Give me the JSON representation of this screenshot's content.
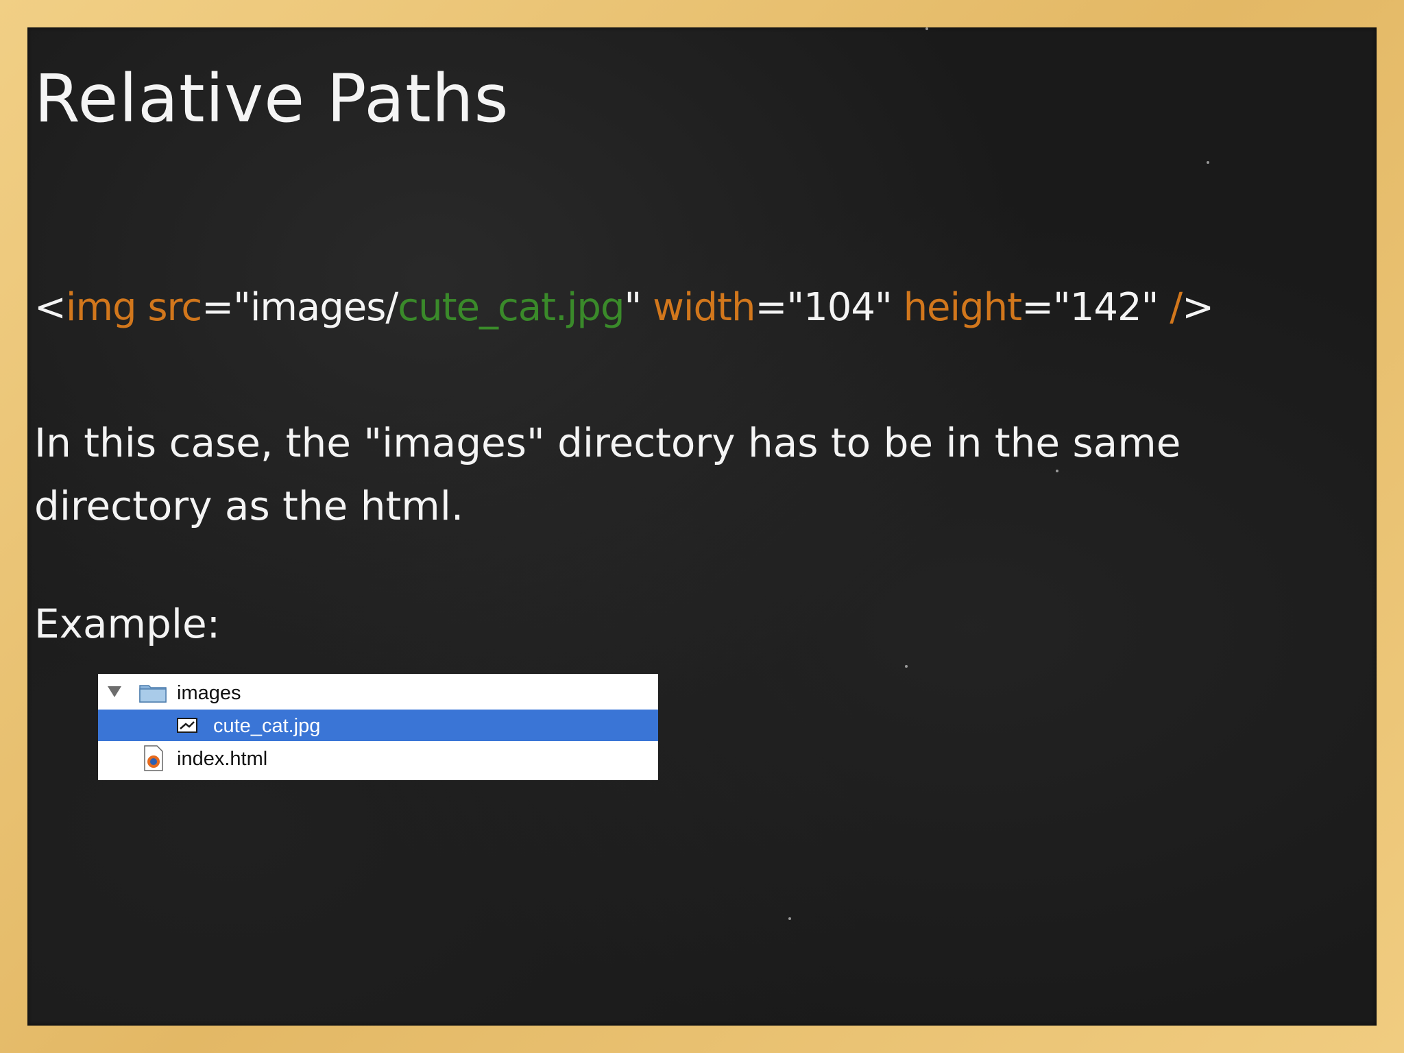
{
  "slide": {
    "title": "Relative Paths",
    "code_tokens": [
      {
        "text": "<",
        "color": "white"
      },
      {
        "text": "img src",
        "color": "orange"
      },
      {
        "text": "=\"images/",
        "color": "white"
      },
      {
        "text": "cute_cat.jpg",
        "color": "green"
      },
      {
        "text": "\" ",
        "color": "white"
      },
      {
        "text": "width",
        "color": "orange"
      },
      {
        "text": "=\"104\" ",
        "color": "white"
      },
      {
        "text": "height",
        "color": "orange"
      },
      {
        "text": "=\"142\" ",
        "color": "white"
      },
      {
        "text": "/",
        "color": "orange"
      },
      {
        "text": ">",
        "color": "white"
      }
    ],
    "paragraph": "In this case, the \"images\" directory has to be in the same directory as the html.",
    "example_label": "Example:"
  },
  "file_list": {
    "items": [
      {
        "name": "images",
        "icon": "folder-icon",
        "expanded": true
      },
      {
        "name": "cute_cat.jpg",
        "icon": "image-file-icon",
        "selected": true
      },
      {
        "name": "index.html",
        "icon": "html-file-icon"
      }
    ]
  },
  "colors": {
    "board": "#1a1a1a",
    "frame": "#e8c272",
    "chalk": "#f4f4f4",
    "code_orange": "#d2771c",
    "code_green": "#3a8a2a",
    "selection": "#3a75d6"
  }
}
